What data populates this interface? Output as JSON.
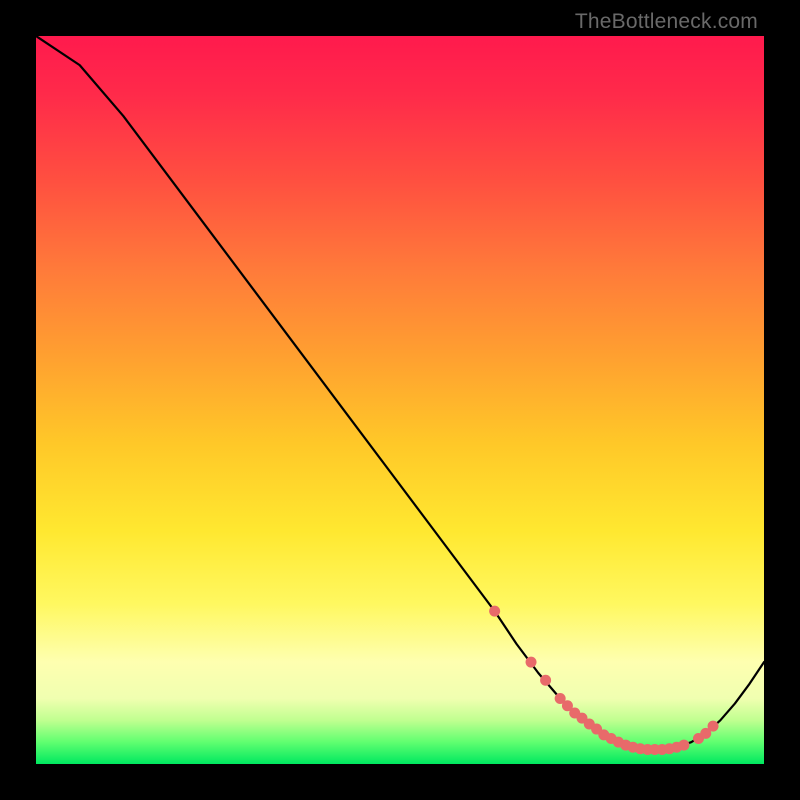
{
  "watermark": "TheBottleneck.com",
  "chart_data": {
    "type": "line",
    "title": "",
    "xlabel": "",
    "ylabel": "",
    "xlim": [
      0,
      100
    ],
    "ylim": [
      0,
      100
    ],
    "series": [
      {
        "name": "bottleneck-curve",
        "x": [
          0,
          6,
          12,
          18,
          24,
          30,
          36,
          42,
          48,
          54,
          60,
          63,
          66,
          69,
          72,
          74,
          76,
          78,
          80,
          82,
          84,
          86,
          88,
          90,
          92,
          94,
          96,
          98,
          100
        ],
        "values": [
          100,
          96,
          89,
          81,
          73,
          65,
          57,
          49,
          41,
          33,
          25,
          21,
          16.5,
          12.5,
          9,
          7,
          5.5,
          4,
          3,
          2.3,
          2,
          2,
          2.3,
          3,
          4.2,
          6,
          8.3,
          11,
          14
        ]
      }
    ],
    "markers": {
      "name": "highlight-points",
      "color": "#e86a6a",
      "x": [
        63,
        68,
        70,
        72,
        73,
        74,
        75,
        76,
        77,
        78,
        79,
        80,
        81,
        82,
        83,
        84,
        85,
        86,
        87,
        88,
        89,
        91,
        92,
        93
      ],
      "values": [
        21,
        14,
        11.5,
        9,
        8,
        7,
        6.3,
        5.5,
        4.8,
        4,
        3.5,
        3,
        2.6,
        2.3,
        2.1,
        2,
        2,
        2,
        2.1,
        2.3,
        2.6,
        3.5,
        4.2,
        5.2
      ]
    },
    "grid": false,
    "legend": false
  }
}
